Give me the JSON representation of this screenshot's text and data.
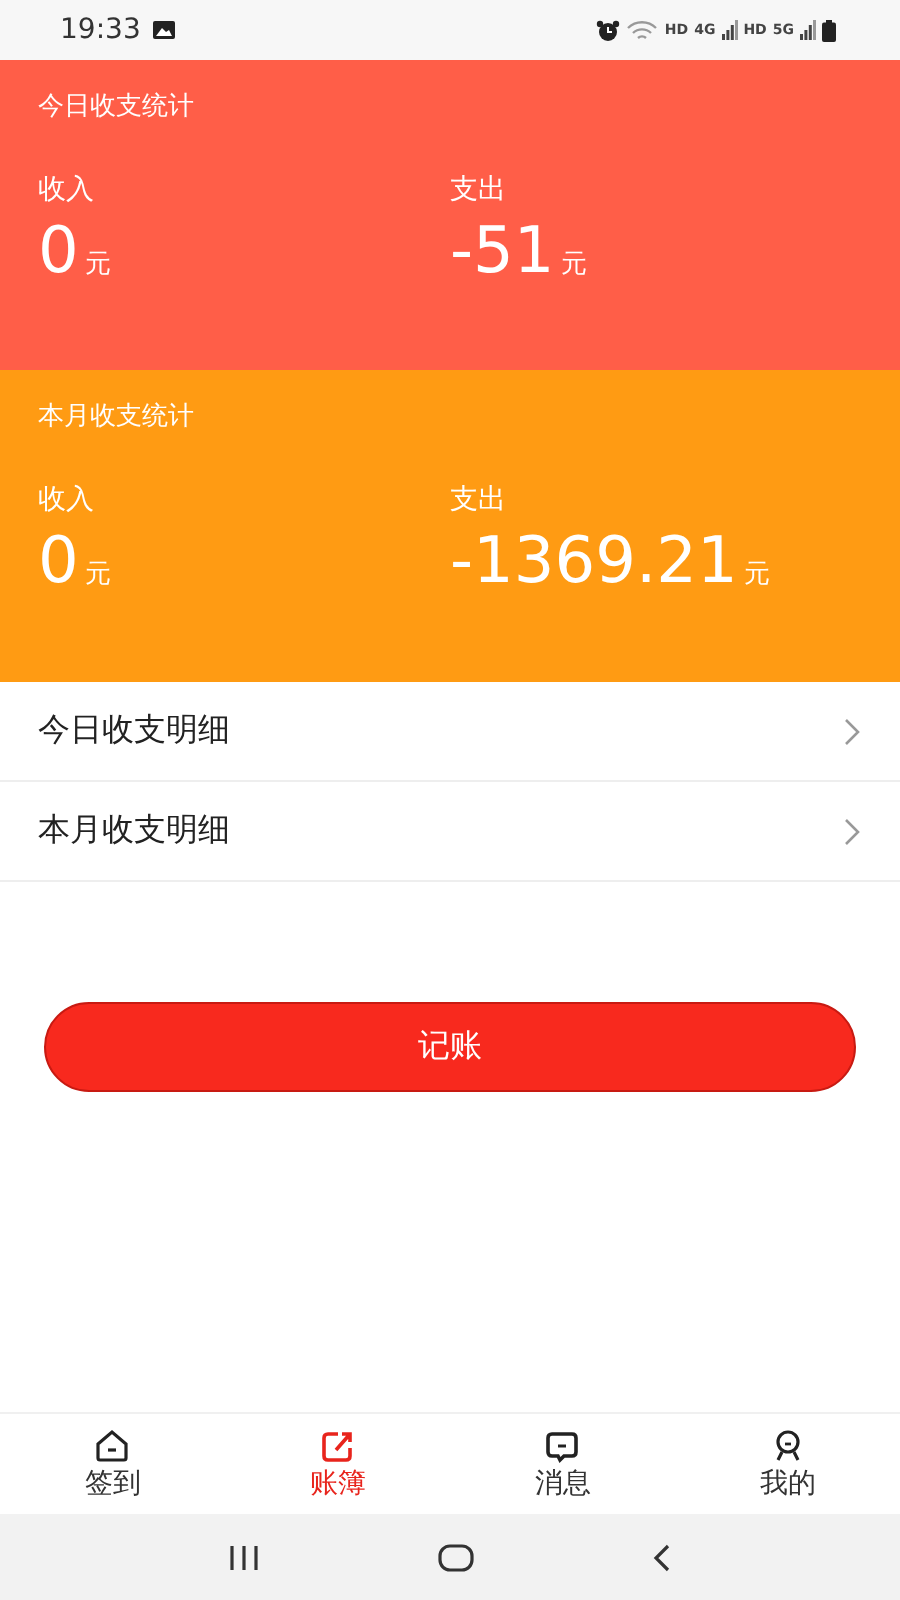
{
  "status_bar": {
    "time": "19:33",
    "indicators": [
      "HD",
      "4G",
      "HD",
      "5G"
    ]
  },
  "stat_panels": [
    {
      "kind": "today",
      "title": "今日收支统计",
      "columns": [
        {
          "label": "收入",
          "amount": "0",
          "unit": "元"
        },
        {
          "label": "支出",
          "amount": "-51",
          "unit": "元"
        }
      ]
    },
    {
      "kind": "month",
      "title": "本月收支统计",
      "columns": [
        {
          "label": "收入",
          "amount": "0",
          "unit": "元"
        },
        {
          "label": "支出",
          "amount": "-1369.21",
          "unit": "元"
        }
      ]
    }
  ],
  "detail_links": [
    {
      "label": "今日收支明细"
    },
    {
      "label": "本月收支明细"
    }
  ],
  "record_button": "记账",
  "tabs": [
    {
      "label": "签到",
      "selected": false
    },
    {
      "label": "账簿",
      "selected": true
    },
    {
      "label": "消息",
      "selected": false
    },
    {
      "label": "我的",
      "selected": false
    }
  ]
}
